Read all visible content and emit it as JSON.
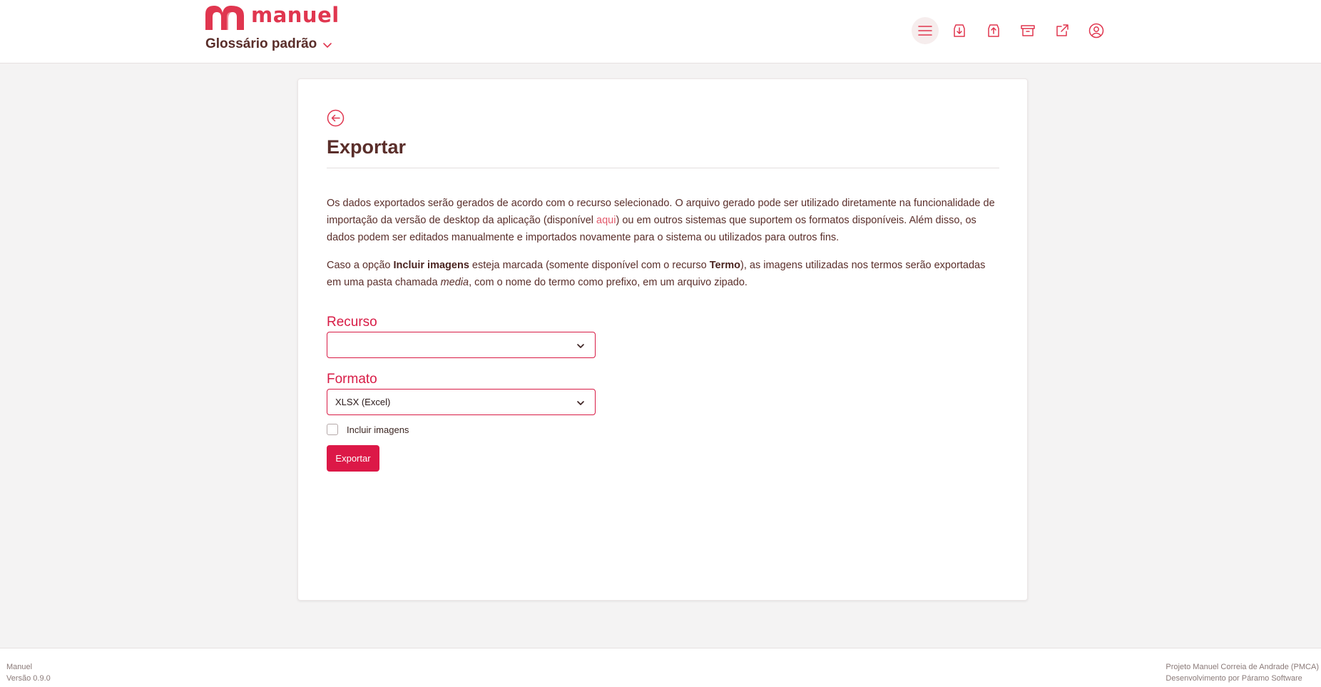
{
  "header": {
    "brand": "manuel",
    "glossary_title": "Glossário padrão",
    "tools": [
      {
        "icon": "menu-icon",
        "label": "Menu"
      },
      {
        "icon": "import-icon",
        "label": "Importar"
      },
      {
        "icon": "export-icon",
        "label": "Exportar"
      },
      {
        "icon": "archive-icon",
        "label": "Arquivo"
      },
      {
        "icon": "external-link-icon",
        "label": "Abrir"
      },
      {
        "icon": "user-icon",
        "label": "Conta"
      }
    ]
  },
  "page": {
    "title": "Exportar",
    "paragraph1": {
      "part1": "Os dados exportados serão gerados de acordo com o recurso selecionado. O arquivo gerado pode ser utilizado diretamente na funcionalidade de importação da versão de desktop da aplicação (disponível ",
      "link": "aqui",
      "part2": ") ou em outros sistemas que suportem os formatos disponíveis. Além disso, os dados podem ser editados manualmente e importados novamente para o sistema ou utilizados para outros fins."
    },
    "paragraph2": {
      "part1": "Caso a opção ",
      "bold1": "Incluir imagens",
      "part2": " esteja marcada (somente disponível com o recurso ",
      "bold2": "Termo",
      "part3": "), as imagens utilizadas nos termos serão exportadas em uma pasta chamada ",
      "italic": "media",
      "part4": ", com o nome do termo como prefixo, em um arquivo zipado."
    },
    "form": {
      "resource_label": "Recurso",
      "resource_value": "",
      "format_label": "Formato",
      "format_value": "XLSX (Excel)",
      "include_images_label": "Incluir imagens",
      "include_images_checked": false,
      "submit_label": "Exportar"
    }
  },
  "footer": {
    "app_name": "Manuel",
    "version": "Versão 0.9.0",
    "project": "Projeto Manuel Correia de Andrade (PMCA)",
    "developer": "Desenvolvimento por Páramo Software"
  },
  "colors": {
    "accent": "#dc1847",
    "brand": "#e0364f",
    "text": "#5a2e2a",
    "background": "#f4f3f3"
  }
}
